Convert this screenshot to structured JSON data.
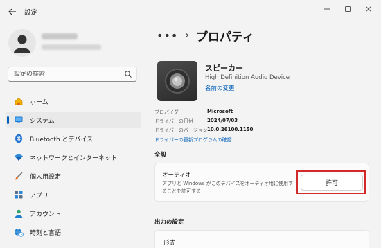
{
  "window": {
    "title": "設定"
  },
  "search": {
    "placeholder": "設定の検索"
  },
  "sidebar": {
    "items": [
      {
        "label": "ホーム",
        "icon": "home-icon"
      },
      {
        "label": "システム",
        "icon": "display-icon",
        "active": true
      },
      {
        "label": "Bluetooth とデバイス",
        "icon": "bluetooth-icon"
      },
      {
        "label": "ネットワークとインターネット",
        "icon": "wifi-icon"
      },
      {
        "label": "個人用設定",
        "icon": "brush-icon"
      },
      {
        "label": "アプリ",
        "icon": "apps-icon"
      },
      {
        "label": "アカウント",
        "icon": "account-icon"
      },
      {
        "label": "時刻と言語",
        "icon": "globe-clock-icon"
      }
    ]
  },
  "breadcrumb": {
    "ellipsis": "•••",
    "separator": "›",
    "title": "プロパティ"
  },
  "device": {
    "name": "スピーカー",
    "description": "High Definition Audio Device",
    "rename_link": "名前の変更"
  },
  "properties": [
    {
      "label": "プロバイダー",
      "value": "Microsoft"
    },
    {
      "label": "ドライバーの日付",
      "value": "2024/07/03"
    },
    {
      "label": "ドライバーのバージョン",
      "value": "10.0.26100.1150"
    }
  ],
  "driver_update_link": "ドライバーの更新プログラムの確認",
  "general": {
    "heading": "全般",
    "audio_title": "オーディオ",
    "audio_description": "アプリと Windows がこのデバイスをオーディオ用に使用することを許可する",
    "allow_button": "許可"
  },
  "output": {
    "heading": "出力の設定",
    "format_label": "形式"
  },
  "colors": {
    "accent": "#005fb8",
    "highlight": "#d12a2a"
  }
}
